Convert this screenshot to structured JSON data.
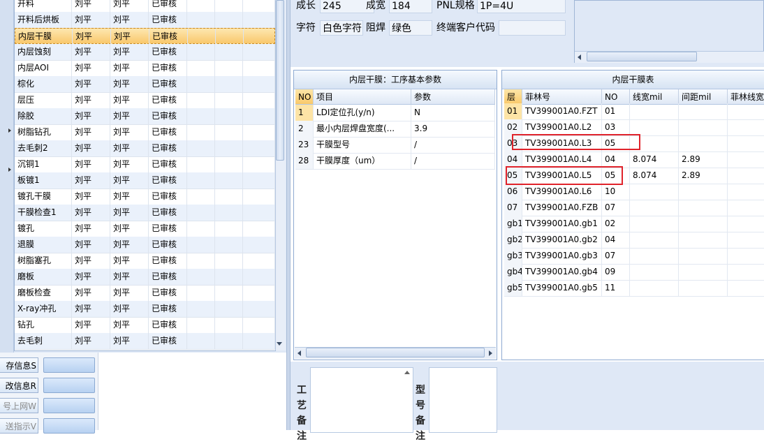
{
  "process_grid": {
    "rows": [
      {
        "name": "开料",
        "c1": "刘平",
        "c2": "刘平",
        "status": "已审核"
      },
      {
        "name": "开料后烘板",
        "c1": "刘平",
        "c2": "刘平",
        "status": "已审核"
      },
      {
        "name": "内层干膜",
        "c1": "刘平",
        "c2": "刘平",
        "status": "已审核"
      },
      {
        "name": "内层蚀刻",
        "c1": "刘平",
        "c2": "刘平",
        "status": "已审核"
      },
      {
        "name": "内层AOI",
        "c1": "刘平",
        "c2": "刘平",
        "status": "已审核"
      },
      {
        "name": "棕化",
        "c1": "刘平",
        "c2": "刘平",
        "status": "已审核"
      },
      {
        "name": "层压",
        "c1": "刘平",
        "c2": "刘平",
        "status": "已审核"
      },
      {
        "name": "除胶",
        "c1": "刘平",
        "c2": "刘平",
        "status": "已审核"
      },
      {
        "name": "树脂钻孔",
        "c1": "刘平",
        "c2": "刘平",
        "status": "已审核"
      },
      {
        "name": "去毛刺2",
        "c1": "刘平",
        "c2": "刘平",
        "status": "已审核"
      },
      {
        "name": "沉铜1",
        "c1": "刘平",
        "c2": "刘平",
        "status": "已审核"
      },
      {
        "name": "板镀1",
        "c1": "刘平",
        "c2": "刘平",
        "status": "已审核"
      },
      {
        "name": "镀孔干膜",
        "c1": "刘平",
        "c2": "刘平",
        "status": "已审核"
      },
      {
        "name": "干膜检查1",
        "c1": "刘平",
        "c2": "刘平",
        "status": "已审核"
      },
      {
        "name": "镀孔",
        "c1": "刘平",
        "c2": "刘平",
        "status": "已审核"
      },
      {
        "name": "退膜",
        "c1": "刘平",
        "c2": "刘平",
        "status": "已审核"
      },
      {
        "name": "树脂塞孔",
        "c1": "刘平",
        "c2": "刘平",
        "status": "已审核"
      },
      {
        "name": "磨板",
        "c1": "刘平",
        "c2": "刘平",
        "status": "已审核"
      },
      {
        "name": "磨板检查",
        "c1": "刘平",
        "c2": "刘平",
        "status": "已审核"
      },
      {
        "name": "X-ray冲孔",
        "c1": "刘平",
        "c2": "刘平",
        "status": "已审核"
      },
      {
        "name": "钻孔",
        "c1": "刘平",
        "c2": "刘平",
        "status": "已审核"
      },
      {
        "name": "去毛刺",
        "c1": "刘平",
        "c2": "刘平",
        "status": "已审核"
      }
    ],
    "selected_index": 2
  },
  "left_buttons": [
    {
      "label": "存信息S",
      "dim": false
    },
    {
      "label": "改信息R",
      "dim": false
    },
    {
      "label": "号上网W",
      "dim": true
    },
    {
      "label": "送指示V",
      "dim": true
    }
  ],
  "top_info": {
    "length_label": "成长",
    "length_value": "245",
    "width_label": "成宽",
    "width_value": "184",
    "pnl_label": "PNL规格",
    "pnl_value": "1P=4U",
    "char_label": "字符",
    "char_value": "白色字符",
    "mask_label": "阻焊",
    "mask_value": "绿色",
    "customer_label": "终端客户代码",
    "customer_value": ""
  },
  "params": {
    "title": "内层干膜：工序基本参数",
    "headers": {
      "no": "NO",
      "item": "项目",
      "param": "参数"
    },
    "rows": [
      {
        "no": "1",
        "item": "LDI定位孔(y/n)",
        "param": "N"
      },
      {
        "no": "2",
        "item": "最小内层焊盘宽度(...",
        "param": "3.9"
      },
      {
        "no": "23",
        "item": "干膜型号",
        "param": "/"
      },
      {
        "no": "28",
        "item": "干膜厚度（um）",
        "param": "/"
      }
    ]
  },
  "film_table": {
    "title": "内层干膜表",
    "headers": {
      "layer": "层",
      "film": "菲林号",
      "no": "NO",
      "line_width": "线宽mil",
      "spacing": "间距mil",
      "film_line": "菲林线宽"
    },
    "rows": [
      {
        "layer": "01",
        "film": "TV399001A0.FZT",
        "no": "01",
        "line_width": "",
        "spacing": ""
      },
      {
        "layer": "02",
        "film": "TV399001A0.L2",
        "no": "03",
        "line_width": "",
        "spacing": ""
      },
      {
        "layer": "03",
        "film": "TV399001A0.L3",
        "no": "05",
        "line_width": "",
        "spacing": ""
      },
      {
        "layer": "04",
        "film": "TV399001A0.L4",
        "no": "04",
        "line_width": "8.074",
        "spacing": "2.89"
      },
      {
        "layer": "05",
        "film": "TV399001A0.L5",
        "no": "05",
        "line_width": "8.074",
        "spacing": "2.89"
      },
      {
        "layer": "06",
        "film": "TV399001A0.L6",
        "no": "10",
        "line_width": "",
        "spacing": ""
      },
      {
        "layer": "07",
        "film": "TV399001A0.FZB",
        "no": "07",
        "line_width": "",
        "spacing": ""
      },
      {
        "layer": "gb1",
        "film": "TV399001A0.gb1",
        "no": "02",
        "line_width": "",
        "spacing": ""
      },
      {
        "layer": "gb2",
        "film": "TV399001A0.gb2",
        "no": "04",
        "line_width": "",
        "spacing": ""
      },
      {
        "layer": "gb3",
        "film": "TV399001A0.gb3",
        "no": "07",
        "line_width": "",
        "spacing": ""
      },
      {
        "layer": "gb4",
        "film": "TV399001A0.gb4",
        "no": "09",
        "line_width": "",
        "spacing": ""
      },
      {
        "layer": "gb5",
        "film": "TV399001A0.gb5",
        "no": "11",
        "line_width": "",
        "spacing": ""
      }
    ]
  },
  "remarks": {
    "process_label": "工艺备注",
    "model_label": "型号备注"
  },
  "colors": {
    "highlight_box": "#e0232b",
    "selected_row": "#f9c86c",
    "panel_bg": "#dfe8f6"
  }
}
